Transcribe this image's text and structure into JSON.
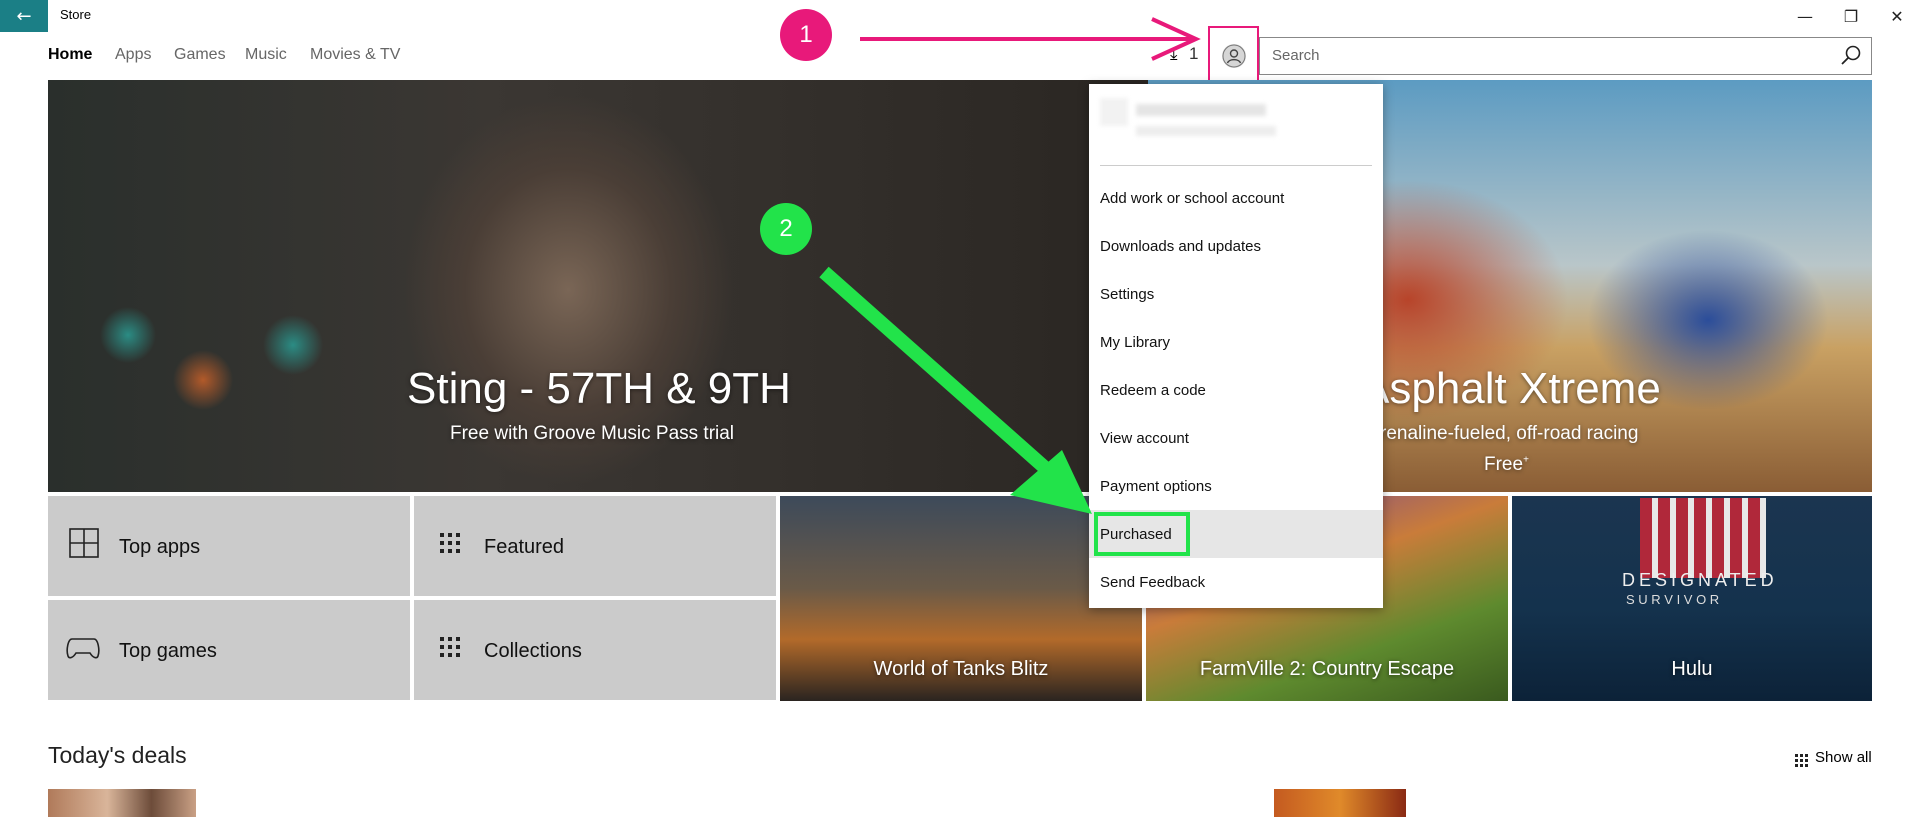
{
  "window": {
    "title": "Store",
    "minimize": "—",
    "maximize": "❐",
    "close": "✕"
  },
  "nav": {
    "items": [
      "Home",
      "Apps",
      "Games",
      "Music",
      "Movies & TV"
    ]
  },
  "header": {
    "download_count": "1",
    "search_placeholder": "Search"
  },
  "hero": {
    "left": {
      "title": "Sting - 57TH & 9TH",
      "subtitle": "Free with Groove Music Pass trial"
    },
    "right": {
      "title": "Asphalt Xtreme",
      "subtitle": "renaline-fueled, off-road racing",
      "price": "Free"
    }
  },
  "tiles": {
    "top_apps": "Top apps",
    "featured": "Featured",
    "top_games": "Top games",
    "collections": "Collections",
    "wot": "World of Tanks Blitz",
    "farmville": "FarmVille 2: Country Escape",
    "hulu": "Hulu",
    "hulu_poster_title": "DESIGNATED",
    "hulu_poster_sub": "S U R V I V O R"
  },
  "menu": {
    "items": [
      "Add work or school account",
      "Downloads and updates",
      "Settings",
      "My Library",
      "Redeem a code",
      "View account",
      "Payment options",
      "Purchased",
      "Send Feedback"
    ]
  },
  "annotations": {
    "step1": "1",
    "step2": "2",
    "pink": "#e8197a",
    "green": "#22e34a"
  },
  "deals": {
    "title": "Today's deals",
    "show_all": "Show all"
  }
}
